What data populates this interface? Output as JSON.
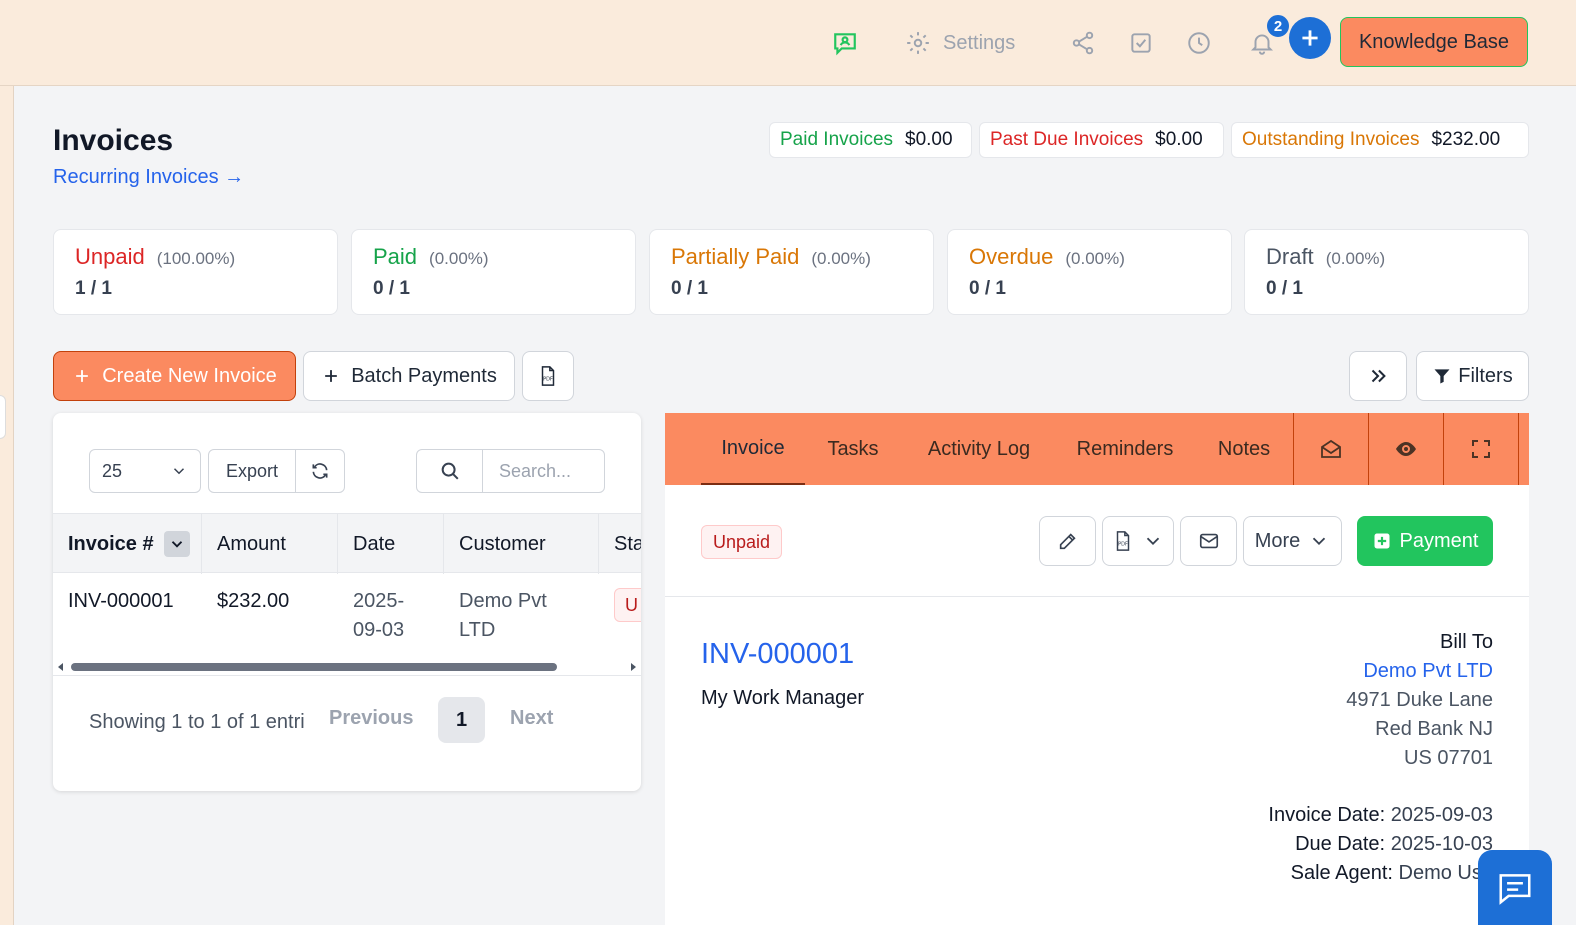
{
  "header": {
    "settings_label": "Settings",
    "notification_count": "2",
    "knowledge_base_label": "Knowledge Base"
  },
  "page": {
    "title": "Invoices",
    "recurring_link": "Recurring Invoices →"
  },
  "summary": [
    {
      "label": "Paid Invoices",
      "value": "$0.00",
      "color": "#16a34a"
    },
    {
      "label": "Past Due Invoices",
      "value": "$0.00",
      "color": "#dc2626"
    },
    {
      "label": "Outstanding Invoices",
      "value": "$232.00",
      "color": "#d97706"
    }
  ],
  "status_cards": [
    {
      "name": "Unpaid",
      "percent": "(100.00%)",
      "count": "1 / 1",
      "color": "#dc2626"
    },
    {
      "name": "Paid",
      "percent": "(0.00%)",
      "count": "0 / 1",
      "color": "#16a34a"
    },
    {
      "name": "Partially Paid",
      "percent": "(0.00%)",
      "count": "0 / 1",
      "color": "#d97706"
    },
    {
      "name": "Overdue",
      "percent": "(0.00%)",
      "count": "0 / 1",
      "color": "#d97706"
    },
    {
      "name": "Draft",
      "percent": "(0.00%)",
      "count": "0 / 1",
      "color": "#4b5563"
    }
  ],
  "toolbar": {
    "create_label": "Create New Invoice",
    "batch_label": "Batch Payments",
    "filters_label": "Filters"
  },
  "table": {
    "page_size": "25",
    "export_label": "Export",
    "search_placeholder": "Search...",
    "columns": [
      "Invoice #",
      "Amount",
      "Date",
      "Customer",
      "Sta"
    ],
    "rows": [
      {
        "invoice": "INV-000001",
        "amount": "$232.00",
        "date_line1": "2025-",
        "date_line2": "09-03",
        "customer_line1": "Demo Pvt",
        "customer_line2": "LTD",
        "status": "U"
      }
    ],
    "showing": "Showing 1 to 1 of 1 entri",
    "previous": "Previous",
    "current_page": "1",
    "next": "Next"
  },
  "detail": {
    "tabs": [
      "Invoice",
      "Tasks",
      "Activity Log",
      "Reminders",
      "Notes"
    ],
    "status": "Unpaid",
    "more_label": "More",
    "payment_label": "Payment",
    "invoice_number": "INV-000001",
    "company": "My Work Manager",
    "bill_to_label": "Bill To",
    "customer": "Demo Pvt LTD",
    "address_line1": "4971 Duke Lane",
    "address_line2": "Red Bank NJ",
    "address_line3": "US 07701",
    "invoice_date_label": "Invoice Date:",
    "invoice_date": "2025-09-03",
    "due_date_label": "Due Date:",
    "due_date": "2025-10-03",
    "sale_agent_label": "Sale Agent:",
    "sale_agent": "Demo Use"
  },
  "colors": {
    "accent": "#fb8a60",
    "header_bg": "#faebdc",
    "primary_blue": "#1d6fd6",
    "success": "#22c55e"
  }
}
